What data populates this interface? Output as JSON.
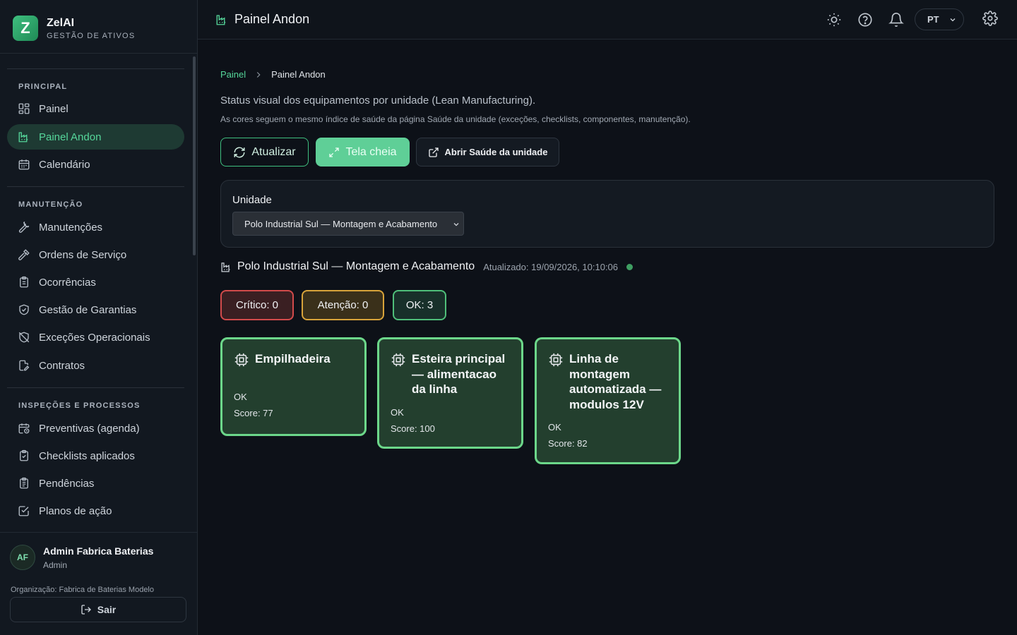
{
  "brand": {
    "logo_letter": "Z",
    "name": "ZelAI",
    "subtitle": "GESTÃO DE ATIVOS"
  },
  "sidebar": {
    "sections": [
      {
        "title": "PRINCIPAL",
        "items": [
          {
            "label": "Painel",
            "icon": "dashboard-icon"
          },
          {
            "label": "Painel Andon",
            "icon": "factory-icon",
            "active": true
          },
          {
            "label": "Calendário",
            "icon": "calendar-icon"
          }
        ]
      },
      {
        "title": "MANUTENÇÃO",
        "items": [
          {
            "label": "Manutenções",
            "icon": "wrench-icon"
          },
          {
            "label": "Ordens de Serviço",
            "icon": "hammer-icon"
          },
          {
            "label": "Ocorrências",
            "icon": "clipboard-icon"
          },
          {
            "label": "Gestão de Garantias",
            "icon": "shield-check-icon"
          },
          {
            "label": "Exceções Operacionais",
            "icon": "shield-off-icon"
          },
          {
            "label": "Contratos",
            "icon": "file-edit-icon"
          }
        ]
      },
      {
        "title": "INSPEÇÕES E PROCESSOS",
        "items": [
          {
            "label": "Preventivas (agenda)",
            "icon": "calendar-clock-icon"
          },
          {
            "label": "Checklists aplicados",
            "icon": "clipboard-check-icon"
          },
          {
            "label": "Pendências",
            "icon": "clipboard-list-icon"
          },
          {
            "label": "Planos de ação",
            "icon": "checkbox-icon"
          }
        ]
      }
    ]
  },
  "user": {
    "initials": "AF",
    "name": "Admin Fabrica Baterias",
    "role": "Admin",
    "organization": "Organização: Fabrica de Baterias Modelo",
    "logout_label": "Sair"
  },
  "topbar": {
    "title": "Painel Andon",
    "language": "PT",
    "icons": [
      "sun-icon",
      "help-icon",
      "bell-icon",
      "settings-icon"
    ]
  },
  "breadcrumb": {
    "home": "Painel",
    "current": "Painel Andon"
  },
  "page": {
    "description": "Status visual dos equipamentos por unidade (Lean Manufacturing).",
    "note": "As cores seguem o mesmo índice de saúde da página Saúde da unidade (exceções, checklists, componentes, manutenção)."
  },
  "actions": {
    "refresh": "Atualizar",
    "fullscreen": "Tela cheia",
    "open_health": "Abrir Saúde da unidade"
  },
  "unit_filter": {
    "label": "Unidade",
    "selected": "Polo Industrial Sul — Montagem e Acabamento"
  },
  "unit_header": {
    "name": "Polo Industrial Sul — Montagem e Acabamento",
    "updated": "Atualizado: 19/09/2026, 10:10:06",
    "status_color": "#3f9f62"
  },
  "summary": {
    "critical": "Crítico: 0",
    "attention": "Atenção: 0",
    "ok": "OK: 3"
  },
  "colors": {
    "accent": "#55d69a",
    "critical": "#d24b4b",
    "attention": "#d8a33a",
    "ok": "#4fbf7a",
    "card_ok_border": "#6cd78a",
    "card_ok_bg": "#233f2e"
  },
  "equipment": [
    {
      "name": "Empilhadeira",
      "status": "OK",
      "score": "Score: 77",
      "icon": "chip-icon"
    },
    {
      "name": "Esteira principal — alimentacao da linha",
      "status": "OK",
      "score": "Score: 100",
      "icon": "chip-icon"
    },
    {
      "name": "Linha de montagem automatizada — modulos 12V",
      "status": "OK",
      "score": "Score: 82",
      "icon": "chip-icon"
    }
  ]
}
